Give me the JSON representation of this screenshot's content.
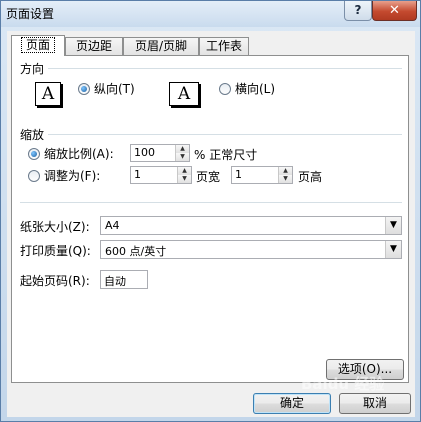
{
  "window": {
    "title": "页面设置",
    "help_glyph": "?",
    "close_glyph": "✕"
  },
  "tabs": [
    {
      "label": "页面",
      "active": true
    },
    {
      "label": "页边距",
      "active": false
    },
    {
      "label": "页眉/页脚",
      "active": false
    },
    {
      "label": "工作表",
      "active": false
    }
  ],
  "orientation": {
    "title": "方向",
    "icon_glyph": "A",
    "portrait": {
      "label": "纵向(T)",
      "selected": true
    },
    "landscape": {
      "label": "横向(L)",
      "selected": false
    }
  },
  "scaling": {
    "title": "缩放",
    "adjust_to": {
      "label": "缩放比例(A):",
      "value": "100",
      "unit": "% 正常尺寸",
      "selected": true
    },
    "fit_to": {
      "label": "调整为(F):",
      "wide_value": "1",
      "wide_unit": "页宽",
      "tall_value": "1",
      "tall_unit": "页高",
      "selected": false
    }
  },
  "paper_size": {
    "label": "纸张大小(Z):",
    "value": "A4"
  },
  "print_quality": {
    "label": "打印质量(Q):",
    "value": "600 点/英寸"
  },
  "first_page": {
    "label": "起始页码(R):",
    "value": "自动"
  },
  "buttons": {
    "options": "选项(O)...",
    "ok": "确定",
    "cancel": "取消"
  },
  "watermark": "Baidu 经验"
}
